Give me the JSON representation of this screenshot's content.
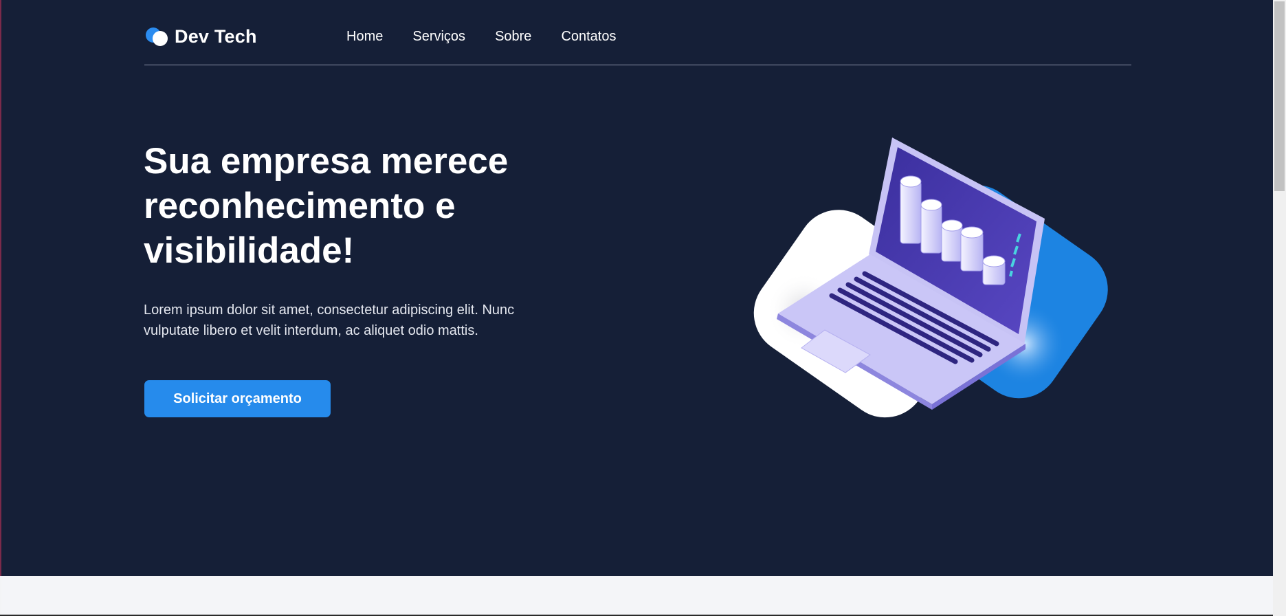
{
  "brand": {
    "name": "Dev Tech"
  },
  "nav": {
    "items": [
      "Home",
      "Serviços",
      "Sobre",
      "Contatos"
    ]
  },
  "hero": {
    "headline": "Sua empresa merece reconhecimento e visibilidade!",
    "lead": "Lorem ipsum dolor sit amet, consectetur adipiscing elit. Nunc vulputate libero et velit interdum, ac aliquet odio mattis.",
    "cta_label": "Solicitar orçamento"
  },
  "colors": {
    "hero_bg": "#151f37",
    "accent": "#268bec",
    "text": "#ffffff"
  },
  "icons": {
    "logo": "two-circles-logo-icon",
    "illustration": "laptop-analytics-illustration"
  }
}
